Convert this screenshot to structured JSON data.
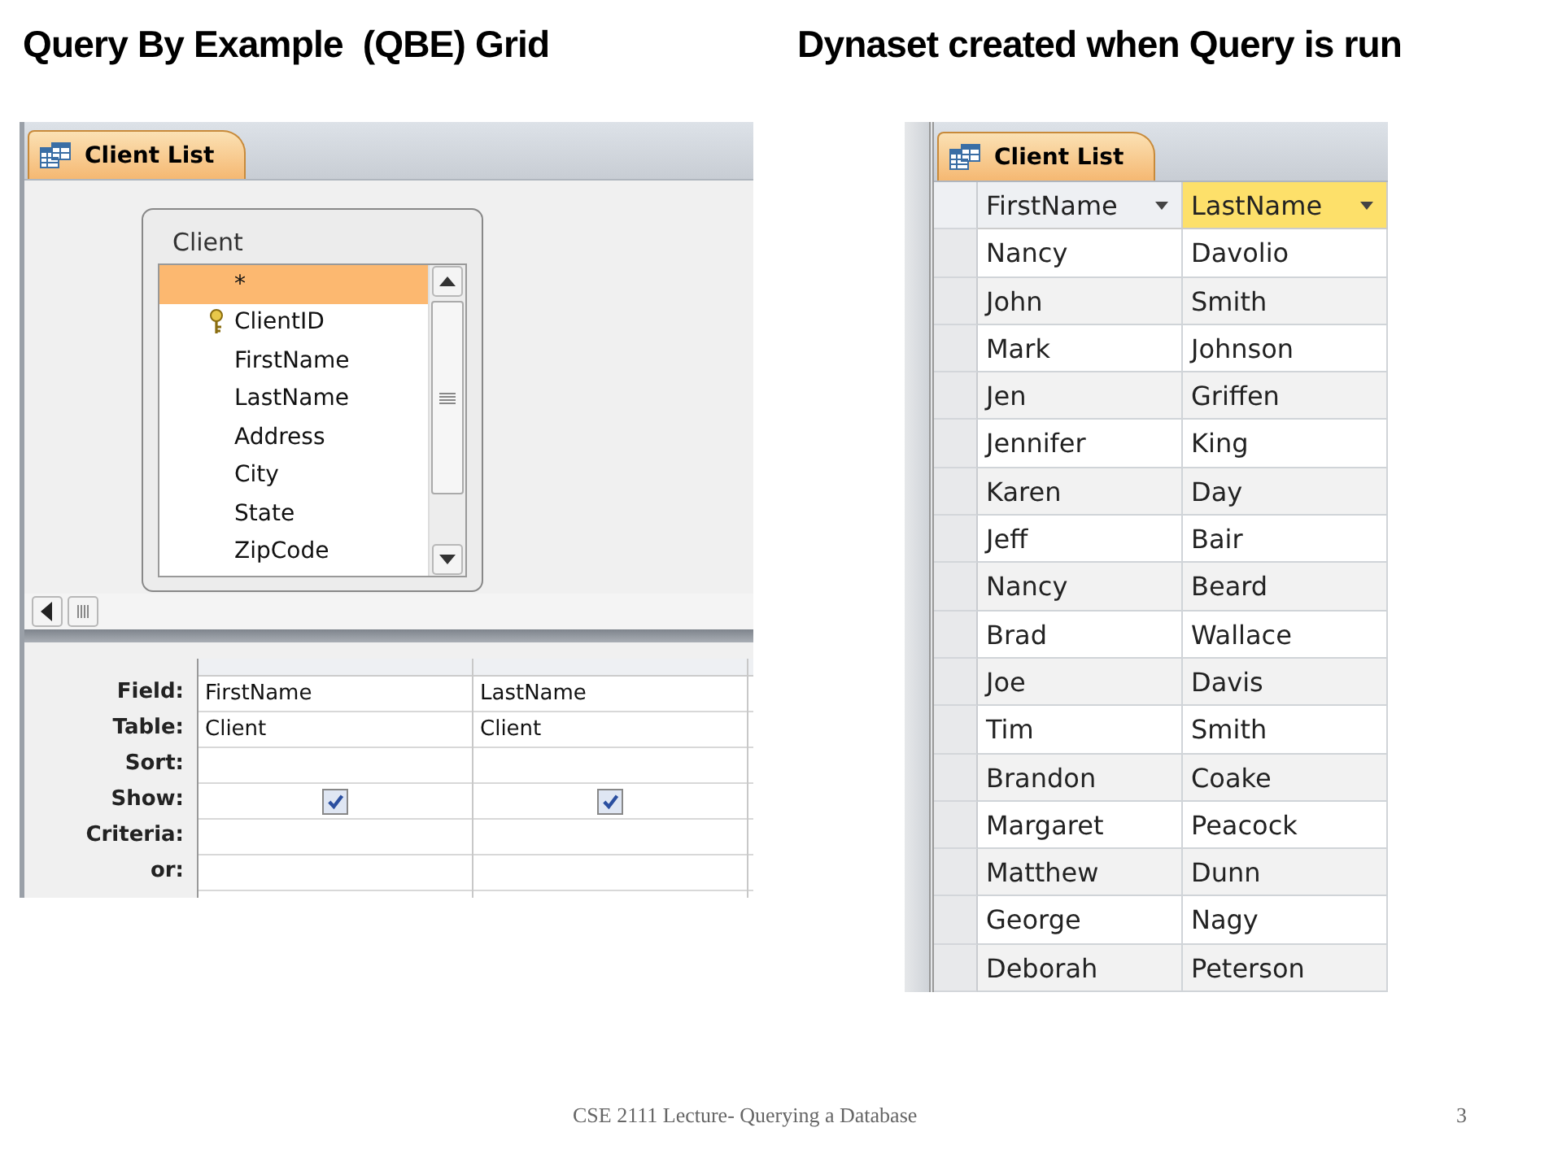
{
  "headings": [
    {
      "text": "Query By Example  (QBE) Grid"
    },
    {
      "text": "Dynaset created when Query is run"
    }
  ],
  "qbe": {
    "tab": {
      "label": "Client List",
      "selected": true
    },
    "field_list": {
      "title": "Client",
      "fields": [
        {
          "name": "*",
          "selected": true,
          "primary_key": false
        },
        {
          "name": "ClientID",
          "selected": false,
          "primary_key": true
        },
        {
          "name": "FirstName",
          "selected": false,
          "primary_key": false
        },
        {
          "name": "LastName",
          "selected": false,
          "primary_key": false
        },
        {
          "name": "Address",
          "selected": false,
          "primary_key": false
        },
        {
          "name": "City",
          "selected": false,
          "primary_key": false
        },
        {
          "name": "State",
          "selected": false,
          "primary_key": false
        },
        {
          "name": "ZipCode",
          "selected": false,
          "primary_key": false
        }
      ]
    },
    "grid": {
      "row_labels": [
        "Field:",
        "Table:",
        "Sort:",
        "Show:",
        "Criteria:",
        "or:"
      ],
      "columns": [
        {
          "field": "FirstName",
          "table": "Client",
          "show": true
        },
        {
          "field": "LastName",
          "table": "Client",
          "show": true
        }
      ]
    }
  },
  "dynaset": {
    "tab": {
      "label": "Client List",
      "selected": true
    },
    "columns": [
      {
        "label": "FirstName",
        "selected": false
      },
      {
        "label": "LastName",
        "selected": true
      }
    ],
    "rows": [
      [
        "Nancy",
        "Davolio"
      ],
      [
        "John",
        "Smith"
      ],
      [
        "Mark",
        "Johnson"
      ],
      [
        "Jen",
        "Griffen"
      ],
      [
        "Jennifer",
        "King"
      ],
      [
        "Karen",
        "Day"
      ],
      [
        "Jeff",
        "Bair"
      ],
      [
        "Nancy",
        "Beard"
      ],
      [
        "Brad",
        "Wallace"
      ],
      [
        "Joe",
        "Davis"
      ],
      [
        "Tim",
        "Smith"
      ],
      [
        "Brandon",
        "Coake"
      ],
      [
        "Margaret",
        "Peacock"
      ],
      [
        "Matthew",
        "Dunn"
      ],
      [
        "George",
        "Nagy"
      ],
      [
        "Deborah",
        "Peterson"
      ]
    ]
  },
  "footer": {
    "text": "CSE 2111 Lecture- Querying a Database",
    "page": "3"
  }
}
